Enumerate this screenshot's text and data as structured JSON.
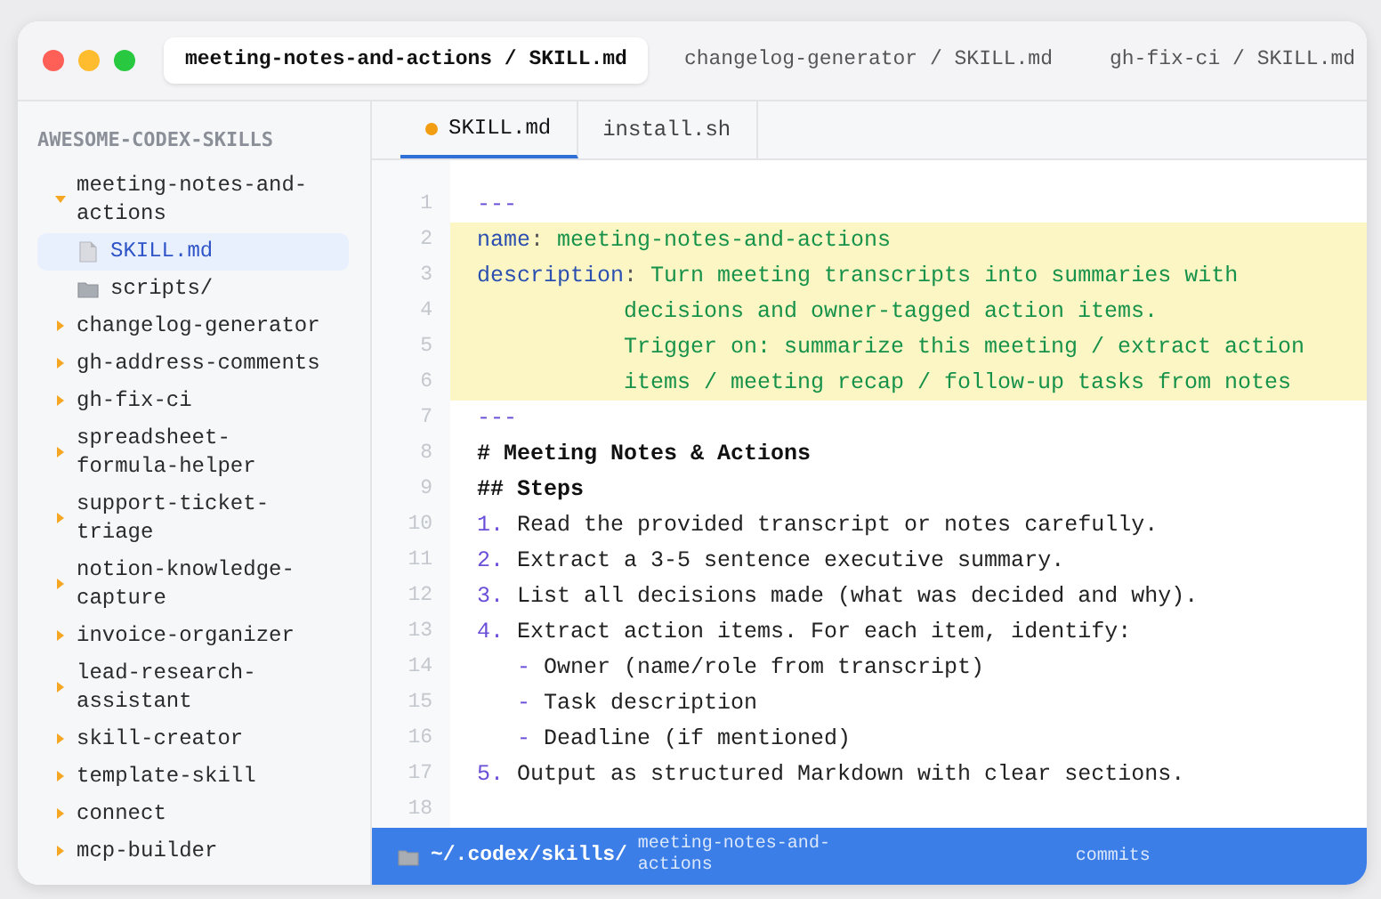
{
  "window": {
    "tabs": [
      {
        "label": "meeting-notes-and-actions / SKILL.md",
        "selected": true
      },
      {
        "label": "changelog-generator / SKILL.md",
        "selected": false
      },
      {
        "label": "gh-fix-ci / SKILL.md",
        "selected": false
      }
    ]
  },
  "sidebar": {
    "title": "AWESOME-CODEX-SKILLS",
    "items": [
      {
        "label": "meeting-notes-and-actions",
        "kind": "skill",
        "expanded": true,
        "children": [
          {
            "label": "SKILL.md",
            "kind": "file",
            "selected": true
          },
          {
            "label": "scripts/",
            "kind": "folder",
            "selected": false
          }
        ]
      },
      {
        "label": "changelog-generator",
        "kind": "skill",
        "expanded": false
      },
      {
        "label": "gh-address-comments",
        "kind": "skill",
        "expanded": false
      },
      {
        "label": "gh-fix-ci",
        "kind": "skill",
        "expanded": false
      },
      {
        "label": "spreadsheet-formula-helper",
        "kind": "skill",
        "expanded": false
      },
      {
        "label": "support-ticket-triage",
        "kind": "skill",
        "expanded": false
      },
      {
        "label": "notion-knowledge-capture",
        "kind": "skill",
        "expanded": false
      },
      {
        "label": "invoice-organizer",
        "kind": "skill",
        "expanded": false
      },
      {
        "label": "lead-research-assistant",
        "kind": "skill",
        "expanded": false
      },
      {
        "label": "skill-creator",
        "kind": "skill",
        "expanded": false
      },
      {
        "label": "template-skill",
        "kind": "skill",
        "expanded": false
      },
      {
        "label": "connect",
        "kind": "skill",
        "expanded": false
      },
      {
        "label": "mcp-builder",
        "kind": "skill",
        "expanded": false
      }
    ]
  },
  "editor": {
    "tabs": [
      {
        "label": "SKILL.md",
        "selected": true,
        "modified": true
      },
      {
        "label": "install.sh",
        "selected": false,
        "modified": false
      }
    ],
    "lines": [
      {
        "number": "1",
        "highlighted": false,
        "kind": "plain",
        "segments": [
          {
            "kind": "rule",
            "text": "---"
          }
        ]
      },
      {
        "number": "2",
        "highlighted": true,
        "kind": "plain",
        "segments": [
          {
            "kind": "key",
            "text": "name"
          },
          {
            "kind": "punct",
            "text": ":"
          },
          {
            "kind": "value",
            "text": " meeting-notes-and-actions"
          }
        ]
      },
      {
        "number": "3",
        "highlighted": true,
        "kind": "plain",
        "segments": [
          {
            "kind": "key",
            "text": "description"
          },
          {
            "kind": "punct",
            "text": ":"
          },
          {
            "kind": "value",
            "text": " Turn meeting transcripts into summaries with"
          }
        ]
      },
      {
        "number": "4",
        "highlighted": true,
        "kind": "continuation",
        "segments": [
          {
            "kind": "value",
            "text": "decisions and owner-tagged action items."
          }
        ]
      },
      {
        "number": "5",
        "highlighted": true,
        "kind": "continuation",
        "segments": [
          {
            "kind": "value",
            "text": "Trigger on: summarize this meeting / extract action"
          }
        ]
      },
      {
        "number": "6",
        "highlighted": true,
        "kind": "continuation",
        "segments": [
          {
            "kind": "value",
            "text": "items / meeting recap / follow-up tasks from notes"
          }
        ]
      },
      {
        "number": "7",
        "highlighted": false,
        "kind": "plain",
        "segments": [
          {
            "kind": "rule",
            "text": "---"
          }
        ]
      },
      {
        "number": "8",
        "highlighted": false,
        "kind": "plain",
        "segments": [
          {
            "kind": "heading",
            "text": "# Meeting Notes & Actions"
          }
        ]
      },
      {
        "number": "9",
        "highlighted": false,
        "kind": "plain",
        "segments": [
          {
            "kind": "heading",
            "text": "## Steps"
          }
        ]
      },
      {
        "number": "10",
        "highlighted": false,
        "kind": "plain",
        "segments": [
          {
            "kind": "marker",
            "text": "1."
          },
          {
            "kind": "text",
            "text": " Read the provided transcript or notes carefully."
          }
        ]
      },
      {
        "number": "11",
        "highlighted": false,
        "kind": "plain",
        "segments": [
          {
            "kind": "marker",
            "text": "2."
          },
          {
            "kind": "text",
            "text": " Extract a 3-5 sentence executive summary."
          }
        ]
      },
      {
        "number": "12",
        "highlighted": false,
        "kind": "plain",
        "segments": [
          {
            "kind": "marker",
            "text": "3."
          },
          {
            "kind": "text",
            "text": " List all decisions made (what was decided and why)."
          }
        ]
      },
      {
        "number": "13",
        "highlighted": false,
        "kind": "plain",
        "segments": [
          {
            "kind": "marker",
            "text": "4."
          },
          {
            "kind": "text",
            "text": " Extract action items. For each item, identify:"
          }
        ]
      },
      {
        "number": "14",
        "highlighted": false,
        "kind": "sub",
        "segments": [
          {
            "kind": "marker",
            "text": "-"
          },
          {
            "kind": "text",
            "text": " Owner (name/role from transcript)"
          }
        ]
      },
      {
        "number": "15",
        "highlighted": false,
        "kind": "sub",
        "segments": [
          {
            "kind": "marker",
            "text": "-"
          },
          {
            "kind": "text",
            "text": " Task description"
          }
        ]
      },
      {
        "number": "16",
        "highlighted": false,
        "kind": "sub",
        "segments": [
          {
            "kind": "marker",
            "text": "-"
          },
          {
            "kind": "text",
            "text": " Deadline (if mentioned)"
          }
        ]
      },
      {
        "number": "17",
        "highlighted": false,
        "kind": "plain",
        "segments": [
          {
            "kind": "marker",
            "text": "5."
          },
          {
            "kind": "text",
            "text": " Output as structured Markdown with clear sections."
          }
        ]
      },
      {
        "number": "18",
        "highlighted": false,
        "kind": "plain"
      }
    ]
  },
  "status_bar": {
    "path": "~/.codex/skills/",
    "skill": "meeting-notes-and-actions",
    "commits": "commits"
  }
}
